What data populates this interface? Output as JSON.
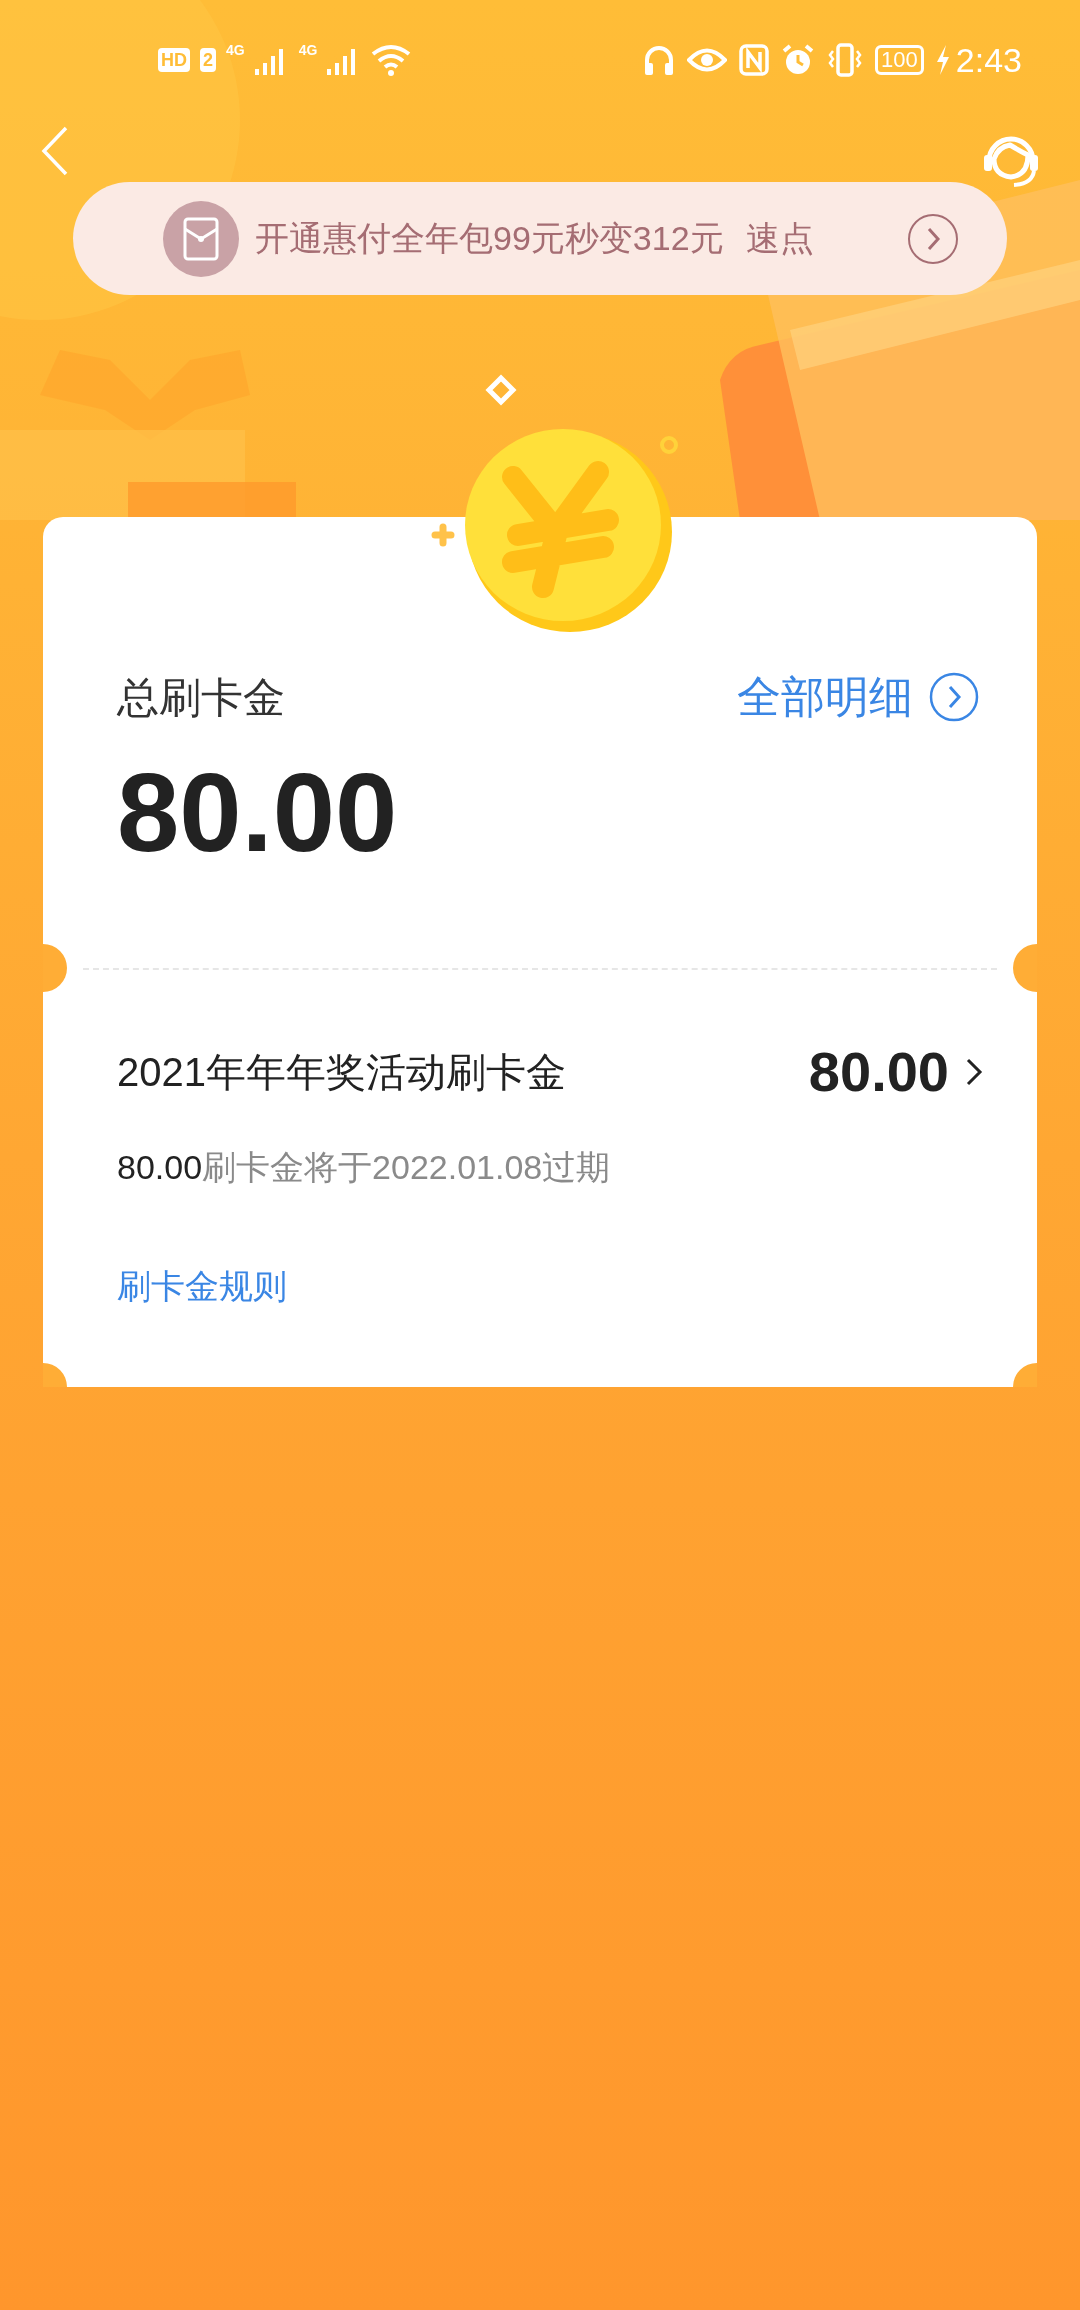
{
  "status_bar": {
    "hd": "HD",
    "sim": "2",
    "network_1": "4G",
    "network_2": "4G",
    "battery": "100",
    "time": "2:43"
  },
  "promo_banner": {
    "text": "开通惠付全年包99元秒变312元",
    "action": "速点"
  },
  "summary": {
    "title": "总刷卡金",
    "details_link": "全部明细",
    "total": "80.00"
  },
  "items": [
    {
      "name": "2021年年年奖活动刷卡金",
      "amount": "80.00",
      "expiry_amount": "80.00",
      "expiry_text": "刷卡金将于2022.01.08过期"
    }
  ],
  "rules_link": "刷卡金规则"
}
